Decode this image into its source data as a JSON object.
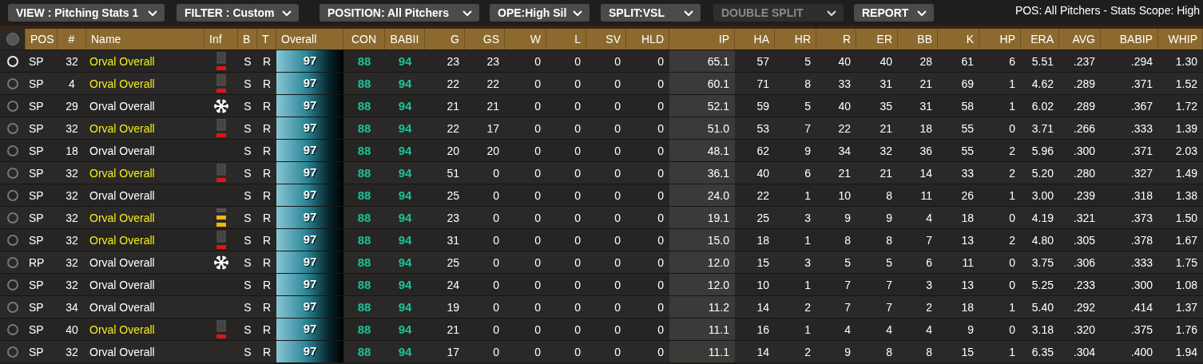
{
  "toolbar": {
    "dropdowns": [
      {
        "label": "VIEW : Pitching Stats 1",
        "disabled": false
      },
      {
        "label": "FILTER : Custom",
        "disabled": false
      },
      {
        "label": "POSITION: All Pitchers",
        "disabled": false
      },
      {
        "label": "OPE:High Sil",
        "disabled": false
      },
      {
        "label": "SPLIT:VSL",
        "disabled": false
      },
      {
        "label": "DOUBLE SPLIT",
        "disabled": true
      },
      {
        "label": "REPORT",
        "disabled": false
      }
    ],
    "status": "POS: All Pitchers - Stats Scope: High"
  },
  "table": {
    "select_all": {
      "selected": false
    },
    "columns": [
      "POS",
      "#",
      "Name",
      "Inf",
      "B",
      "T",
      "Overall",
      "CON",
      "BABII",
      "G",
      "GS",
      "W",
      "L",
      "SV",
      "HLD",
      "IP",
      "HA",
      "HR",
      "R",
      "ER",
      "BB",
      "K",
      "HP",
      "ERA",
      "AVG",
      "BABIP",
      "WHIP"
    ],
    "rows": [
      {
        "selected": true,
        "pos": "SP",
        "num": "32",
        "name": "Orval Overall",
        "highlighted": true,
        "kind": "cold",
        "b": "S",
        "t": "R",
        "overall": "97",
        "con": "88",
        "pbabip": "94",
        "stats": [
          "23",
          "23",
          "0",
          "0",
          "0",
          "0",
          "65.1",
          "57",
          "5",
          "40",
          "40",
          "28",
          "61",
          "6",
          "5.51",
          ".237",
          ".294",
          "1.30"
        ]
      },
      {
        "selected": false,
        "pos": "SP",
        "num": "4",
        "name": "Orval Overall",
        "highlighted": true,
        "kind": "cold",
        "b": "S",
        "t": "R",
        "overall": "97",
        "con": "88",
        "pbabip": "94",
        "stats": [
          "22",
          "22",
          "0",
          "0",
          "0",
          "0",
          "60.1",
          "71",
          "8",
          "33",
          "31",
          "21",
          "69",
          "1",
          "4.62",
          ".289",
          ".371",
          "1.52"
        ]
      },
      {
        "selected": false,
        "pos": "SP",
        "num": "29",
        "name": "Orval Overall",
        "highlighted": false,
        "kind": "ice",
        "b": "S",
        "t": "R",
        "overall": "97",
        "con": "88",
        "pbabip": "94",
        "stats": [
          "21",
          "21",
          "0",
          "0",
          "0",
          "0",
          "52.1",
          "59",
          "5",
          "40",
          "35",
          "31",
          "58",
          "1",
          "6.02",
          ".289",
          ".367",
          "1.72"
        ]
      },
      {
        "selected": false,
        "pos": "SP",
        "num": "32",
        "name": "Orval Overall",
        "highlighted": true,
        "kind": "cold",
        "b": "S",
        "t": "R",
        "overall": "97",
        "con": "88",
        "pbabip": "94",
        "stats": [
          "22",
          "17",
          "0",
          "0",
          "0",
          "0",
          "51.0",
          "53",
          "7",
          "22",
          "21",
          "18",
          "55",
          "0",
          "3.71",
          ".266",
          ".333",
          "1.39"
        ]
      },
      {
        "selected": false,
        "pos": "SP",
        "num": "18",
        "name": "Orval Overall",
        "highlighted": false,
        "kind": "none",
        "b": "S",
        "t": "R",
        "overall": "97",
        "con": "88",
        "pbabip": "94",
        "stats": [
          "20",
          "20",
          "0",
          "0",
          "0",
          "0",
          "48.1",
          "62",
          "9",
          "34",
          "32",
          "36",
          "55",
          "2",
          "5.96",
          ".300",
          ".371",
          "2.03"
        ]
      },
      {
        "selected": false,
        "pos": "SP",
        "num": "32",
        "name": "Orval Overall",
        "highlighted": true,
        "kind": "cold",
        "b": "S",
        "t": "R",
        "overall": "97",
        "con": "88",
        "pbabip": "94",
        "stats": [
          "51",
          "0",
          "0",
          "0",
          "0",
          "0",
          "36.1",
          "40",
          "6",
          "21",
          "21",
          "14",
          "33",
          "2",
          "5.20",
          ".280",
          ".327",
          "1.49"
        ]
      },
      {
        "selected": false,
        "pos": "SP",
        "num": "32",
        "name": "Orval Overall",
        "highlighted": false,
        "kind": "none",
        "b": "S",
        "t": "R",
        "overall": "97",
        "con": "88",
        "pbabip": "94",
        "stats": [
          "25",
          "0",
          "0",
          "0",
          "0",
          "0",
          "24.0",
          "22",
          "1",
          "10",
          "8",
          "11",
          "26",
          "1",
          "3.00",
          ".239",
          ".318",
          "1.38"
        ]
      },
      {
        "selected": false,
        "pos": "SP",
        "num": "32",
        "name": "Orval Overall",
        "highlighted": true,
        "kind": "warm",
        "b": "S",
        "t": "R",
        "overall": "97",
        "con": "88",
        "pbabip": "94",
        "stats": [
          "23",
          "0",
          "0",
          "0",
          "0",
          "0",
          "19.1",
          "25",
          "3",
          "9",
          "9",
          "4",
          "18",
          "0",
          "4.19",
          ".321",
          ".373",
          "1.50"
        ]
      },
      {
        "selected": false,
        "pos": "SP",
        "num": "32",
        "name": "Orval Overall",
        "highlighted": true,
        "kind": "cold",
        "b": "S",
        "t": "R",
        "overall": "97",
        "con": "88",
        "pbabip": "94",
        "stats": [
          "31",
          "0",
          "0",
          "0",
          "0",
          "0",
          "15.0",
          "18",
          "1",
          "8",
          "8",
          "7",
          "13",
          "2",
          "4.80",
          ".305",
          ".378",
          "1.67"
        ]
      },
      {
        "selected": false,
        "pos": "RP",
        "num": "32",
        "name": "Orval Overall",
        "highlighted": false,
        "kind": "ice",
        "b": "S",
        "t": "R",
        "overall": "97",
        "con": "88",
        "pbabip": "94",
        "stats": [
          "25",
          "0",
          "0",
          "0",
          "0",
          "0",
          "12.0",
          "15",
          "3",
          "5",
          "5",
          "6",
          "11",
          "0",
          "3.75",
          ".306",
          ".333",
          "1.75"
        ]
      },
      {
        "selected": false,
        "pos": "SP",
        "num": "32",
        "name": "Orval Overall",
        "highlighted": false,
        "kind": "none",
        "b": "S",
        "t": "R",
        "overall": "97",
        "con": "88",
        "pbabip": "94",
        "stats": [
          "24",
          "0",
          "0",
          "0",
          "0",
          "0",
          "12.0",
          "10",
          "1",
          "7",
          "7",
          "3",
          "13",
          "0",
          "5.25",
          ".233",
          ".300",
          "1.08"
        ]
      },
      {
        "selected": false,
        "pos": "SP",
        "num": "34",
        "name": "Orval Overall",
        "highlighted": false,
        "kind": "none",
        "b": "S",
        "t": "R",
        "overall": "97",
        "con": "88",
        "pbabip": "94",
        "stats": [
          "19",
          "0",
          "0",
          "0",
          "0",
          "0",
          "11.2",
          "14",
          "2",
          "7",
          "7",
          "2",
          "18",
          "1",
          "5.40",
          ".292",
          ".414",
          "1.37"
        ]
      },
      {
        "selected": false,
        "pos": "SP",
        "num": "40",
        "name": "Orval Overall",
        "highlighted": true,
        "kind": "cold",
        "b": "S",
        "t": "R",
        "overall": "97",
        "con": "88",
        "pbabip": "94",
        "stats": [
          "21",
          "0",
          "0",
          "0",
          "0",
          "0",
          "11.1",
          "16",
          "1",
          "4",
          "4",
          "4",
          "9",
          "0",
          "3.18",
          ".320",
          ".375",
          "1.76"
        ]
      },
      {
        "selected": false,
        "pos": "SP",
        "num": "32",
        "name": "Orval Overall",
        "highlighted": false,
        "kind": "none",
        "b": "S",
        "t": "R",
        "overall": "97",
        "con": "88",
        "pbabip": "94",
        "stats": [
          "17",
          "0",
          "0",
          "0",
          "0",
          "0",
          "11.1",
          "14",
          "2",
          "9",
          "8",
          "8",
          "15",
          "1",
          "6.35",
          ".304",
          ".400",
          "1.94"
        ]
      }
    ]
  }
}
